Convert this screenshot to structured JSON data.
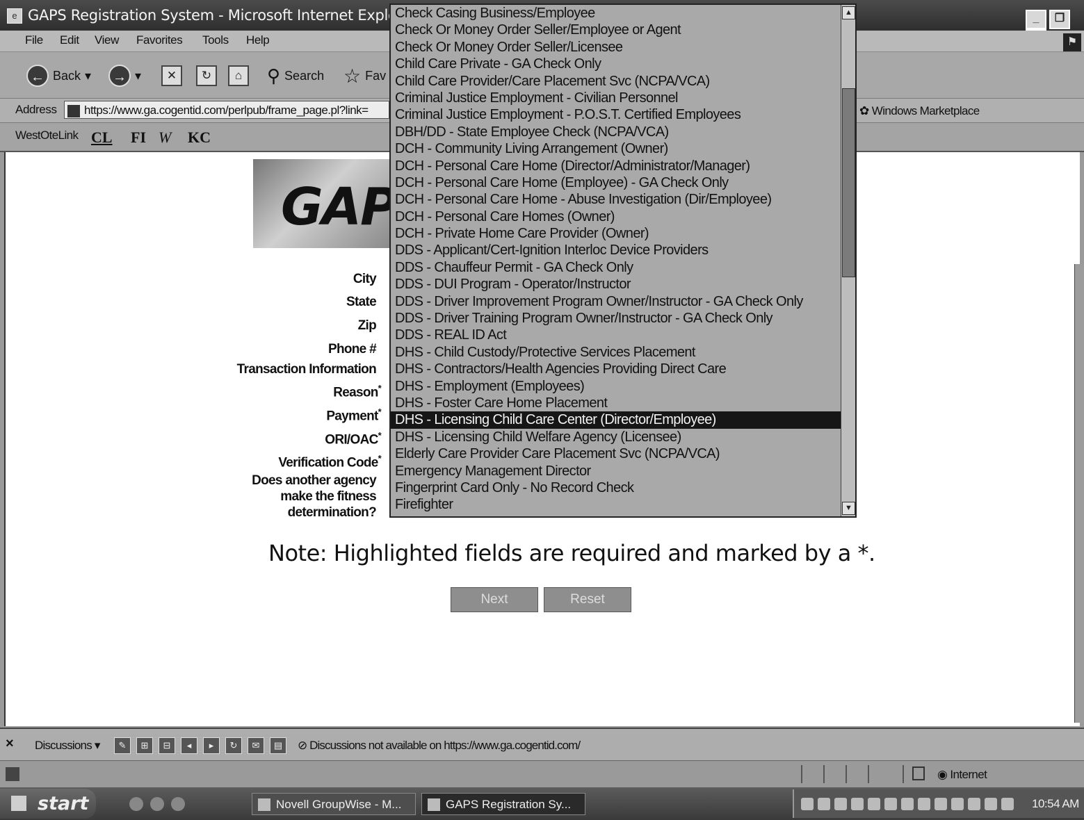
{
  "window": {
    "title": "GAPS Registration System - Microsoft Internet Explorer",
    "minimize": "_",
    "restore": "❐",
    "close": "×"
  },
  "menu": [
    "File",
    "Edit",
    "View",
    "Favorites",
    "Tools",
    "Help"
  ],
  "toolbar": {
    "back": "Back",
    "search": "Search",
    "favorites": "Fav"
  },
  "address": {
    "label": "Address",
    "url": "https://www.ga.cogentid.com/perlpub/frame_page.pl?link=",
    "windows_marketplace": "Windows Marketplace"
  },
  "links": {
    "westotelink": "WestOteLink",
    "cl": "CL",
    "fi": "FI",
    "kc": "KC"
  },
  "logo": {
    "text": "GAPS"
  },
  "form": {
    "city": "City",
    "state": "State",
    "zip": "Zip",
    "phone": "Phone #",
    "transaction_info": "Transaction Information",
    "reason": "Reason",
    "payment": "Payment",
    "ori_oac": "ORI/OAC",
    "verification": "Verification Code",
    "asterisk": "*",
    "fitness_question": "Does another agency make the fitness determination?"
  },
  "note": "Note: Highlighted fields are required and marked by a *.",
  "buttons": {
    "next": "Next",
    "reset": "Reset"
  },
  "reason_dropdown": {
    "selected_index": 24,
    "options": [
      "Check Casing Business/Employee",
      "Check Or Money Order Seller/Employee or Agent",
      "Check Or Money Order Seller/Licensee",
      "Child Care Private - GA Check Only",
      "Child Care Provider/Care Placement Svc (NCPA/VCA)",
      "Criminal Justice Employment - Civilian Personnel",
      "Criminal Justice Employment - P.O.S.T. Certified Employees",
      "DBH/DD - State Employee Check (NCPA/VCA)",
      "DCH - Community Living Arrangement (Owner)",
      "DCH - Personal Care Home (Director/Administrator/Manager)",
      "DCH - Personal Care Home (Employee) - GA Check Only",
      "DCH - Personal Care Home - Abuse Investigation (Dir/Employee)",
      "DCH - Personal Care Homes (Owner)",
      "DCH - Private Home Care Provider (Owner)",
      "DDS - Applicant/Cert-Ignition Interloc Device Providers",
      "DDS - Chauffeur Permit - GA Check Only",
      "DDS - DUI Program - Operator/Instructor",
      "DDS - Driver Improvement Program Owner/Instructor - GA Check Only",
      "DDS - Driver Training Program Owner/Instructor - GA Check Only",
      "DDS - REAL ID Act",
      "DHS - Child Custody/Protective Services Placement",
      "DHS - Contractors/Health Agencies Providing Direct Care",
      "DHS - Employment (Employees)",
      "DHS - Foster Care Home Placement",
      "DHS - Licensing Child Care Center (Director/Employee)",
      "DHS - Licensing Child Welfare Agency (Licensee)",
      "Elderly Care Provider Care Placement Svc (NCPA/VCA)",
      "Emergency Management Director",
      "Fingerprint Card Only - No Record Check",
      "Firefighter"
    ]
  },
  "discussions": {
    "label": "Discussions",
    "message": "Discussions not available on https://www.ga.cogentid.com/"
  },
  "status": {
    "zone": "Internet"
  },
  "taskbar": {
    "start": "start",
    "tasks": [
      "Novell GroupWise - M...",
      "GAPS Registration Sy..."
    ],
    "clock": "10:54 AM"
  }
}
